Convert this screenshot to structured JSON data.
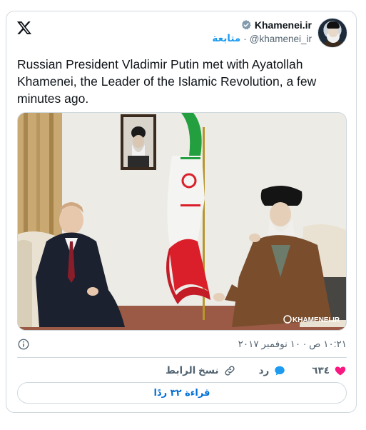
{
  "header": {
    "display_name": "Khamenei.ir",
    "handle": "@khamenei_ir",
    "separator": "·",
    "follow_label": "متابعة"
  },
  "tweet": {
    "text": "Russian President Vladimir Putin met with Ayatollah Khamenei, the Leader of the Islamic Revolution, a few minutes ago.",
    "watermark": "KHAMENEI.IR",
    "timestamp": "١٠:٢١ ص · ١٠ نوفمبر ٢٠١٧"
  },
  "actions": {
    "like_count": "٦٣٤",
    "reply_label": "رد",
    "copy_link_label": "نسخ الرابط"
  },
  "read_replies_label": "قراءة ٣٢ ردًا",
  "colors": {
    "accent": "#1d9bf0",
    "link_blue": "#006fd6",
    "like_red": "#f91880",
    "border": "#cfd9de",
    "muted": "#536471"
  },
  "icons": {
    "logo": "x-logo-icon",
    "verified": "verified-badge-icon",
    "info": "info-icon",
    "like": "heart-icon",
    "reply": "reply-bubble-icon",
    "copy": "link-icon"
  }
}
